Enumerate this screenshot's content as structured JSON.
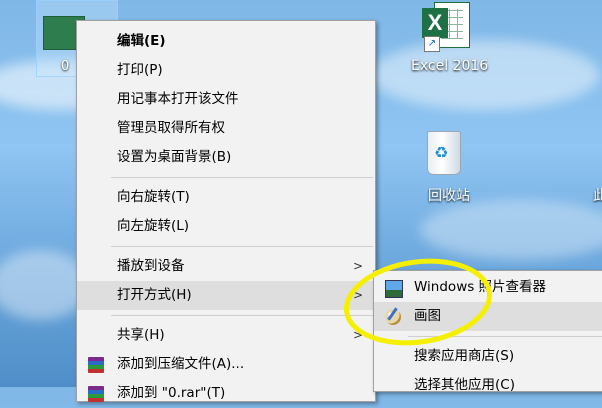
{
  "desktop": {
    "selected_file_label": "0",
    "excel_label": "Excel 2016",
    "recycle_bin_label": "回收站",
    "edge_label_partial": "此"
  },
  "context_menu": {
    "items": [
      {
        "label": "编辑(E)",
        "bold": true
      },
      {
        "label": "打印(P)"
      },
      {
        "label": "用记事本打开该文件"
      },
      {
        "label": "管理员取得所有权"
      },
      {
        "label": "设置为桌面背景(B)"
      },
      {
        "label": "向右旋转(T)"
      },
      {
        "label": "向左旋转(L)"
      },
      {
        "label": "播放到设备",
        "submenu_arrow": ">"
      },
      {
        "label": "打开方式(H)",
        "submenu_arrow": ">"
      },
      {
        "label": "共享(H)",
        "submenu_arrow": ">"
      },
      {
        "label": "添加到压缩文件(A)...",
        "icon": "winrar-icon"
      },
      {
        "label": "添加到 \"0.rar\"(T)",
        "icon": "winrar-icon"
      }
    ]
  },
  "open_with_submenu": {
    "items": [
      {
        "label": "Windows 照片查看器",
        "icon": "photo-viewer-icon"
      },
      {
        "label": "画图",
        "icon": "paint-icon"
      },
      {
        "label": "搜索应用商店(S)"
      },
      {
        "label": "选择其他应用(C)"
      }
    ]
  },
  "colors": {
    "menu_bg": "#f2f2f2",
    "menu_hover": "#dedede",
    "annotation": "#f5f000",
    "excel_green": "#1e7145"
  }
}
